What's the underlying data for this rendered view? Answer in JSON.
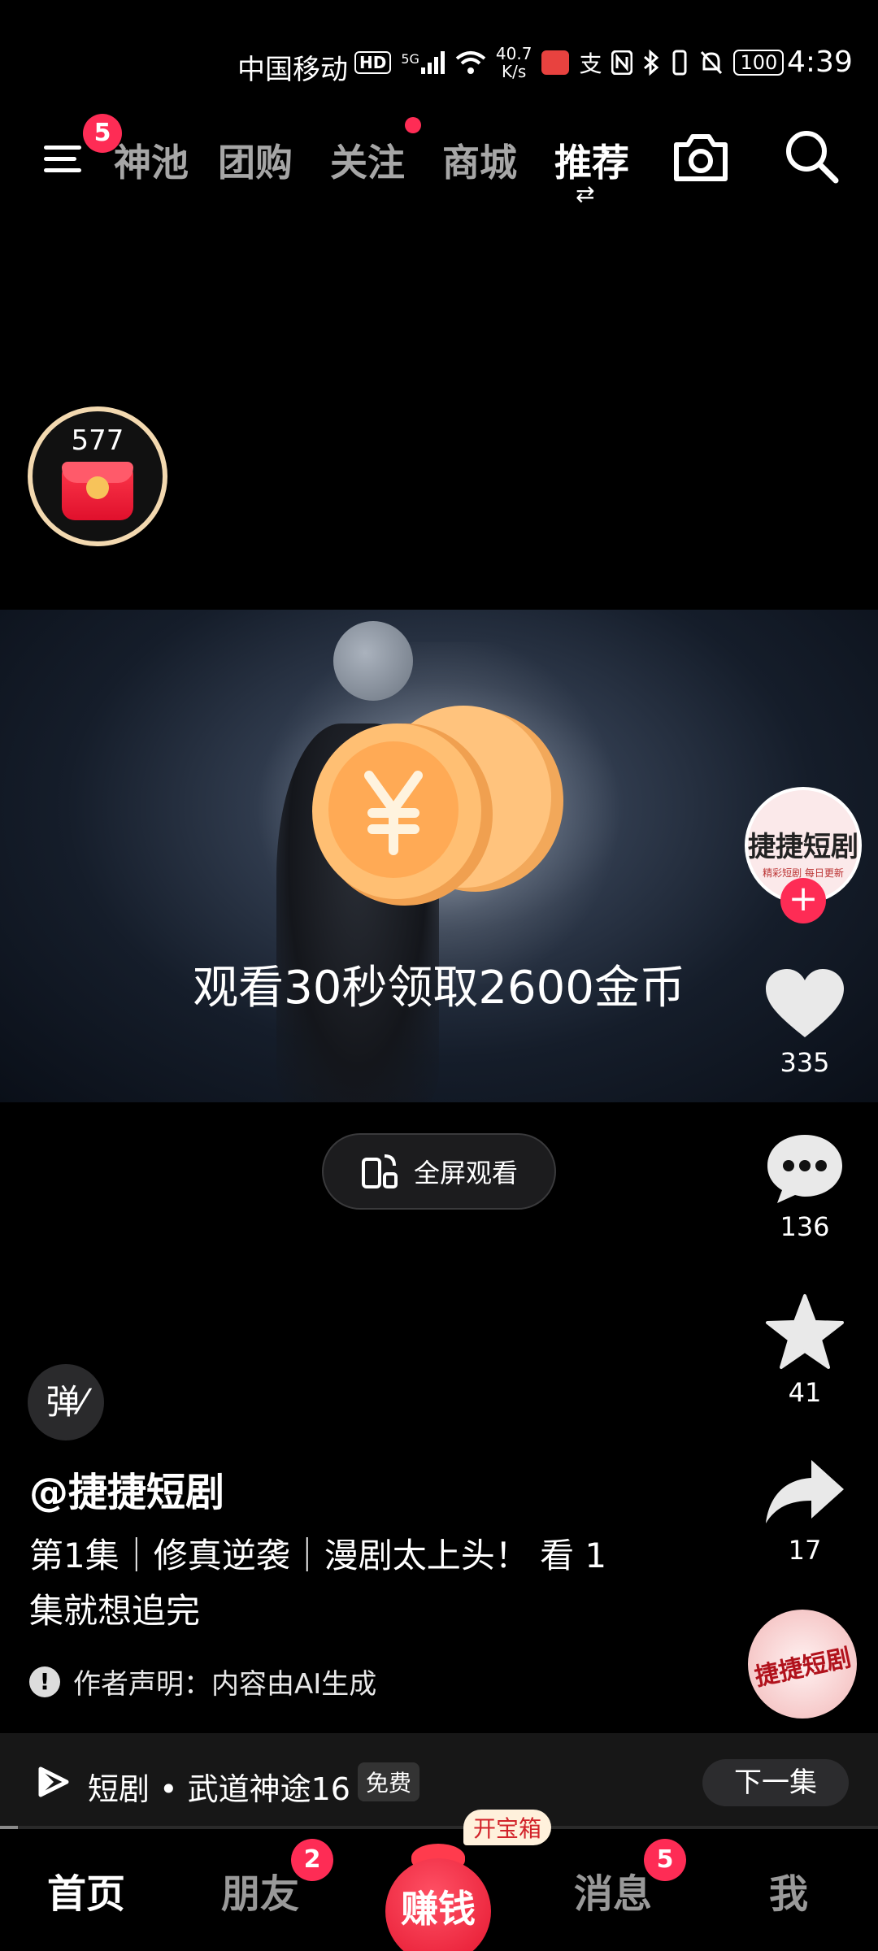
{
  "status_bar": {
    "carrier": "中国移动",
    "hd": "HD",
    "network_type": "5G",
    "net_speed_value": "40.7",
    "net_speed_unit": "K/s",
    "battery": "100",
    "time": "4:39",
    "icons": [
      "hd-icon",
      "signal-icon",
      "wifi-icon",
      "store-app-icon",
      "alipay-icon",
      "nfc-icon",
      "bluetooth-icon",
      "vibrate-icon",
      "mute-icon",
      "battery-icon"
    ]
  },
  "top_nav": {
    "menu_badge": "5",
    "tabs": [
      {
        "label": "神池",
        "active": false
      },
      {
        "label": "团购",
        "active": false
      },
      {
        "label": "关注",
        "active": false
      },
      {
        "label": "商城",
        "active": false
      },
      {
        "label": "推荐",
        "active": true
      }
    ]
  },
  "reward": {
    "count": "577"
  },
  "video": {
    "caption": "观看30秒领取2600金币"
  },
  "fullscreen_button": {
    "label": "全屏观看"
  },
  "right_rail": {
    "avatar_name": "捷捷短剧",
    "avatar_sub": "精彩短剧 每日更新",
    "likes": "335",
    "comments": "136",
    "favorites": "41",
    "shares": "17"
  },
  "danmaku_label": "弹",
  "post": {
    "author": "@捷捷短剧",
    "description": "第1集｜修真逆袭｜漫剧太上头！ 看 1 集就想追完",
    "declaration": "作者声明：内容由AI生成"
  },
  "music_disc_label": "捷捷短剧",
  "playlet_bar": {
    "title": "短剧 • 武道神途16",
    "tag": "免费",
    "next_label": "下一集",
    "progress": 0.02
  },
  "bottom_nav": {
    "tabs": [
      {
        "label": "首页",
        "active": true
      },
      {
        "label": "朋友",
        "badge": "2"
      },
      {
        "label": "赚钱",
        "tag": "开宝箱"
      },
      {
        "label": "消息",
        "badge": "5"
      },
      {
        "label": "我"
      }
    ]
  },
  "colors": {
    "accent": "#fe2c55",
    "background": "#000000"
  }
}
